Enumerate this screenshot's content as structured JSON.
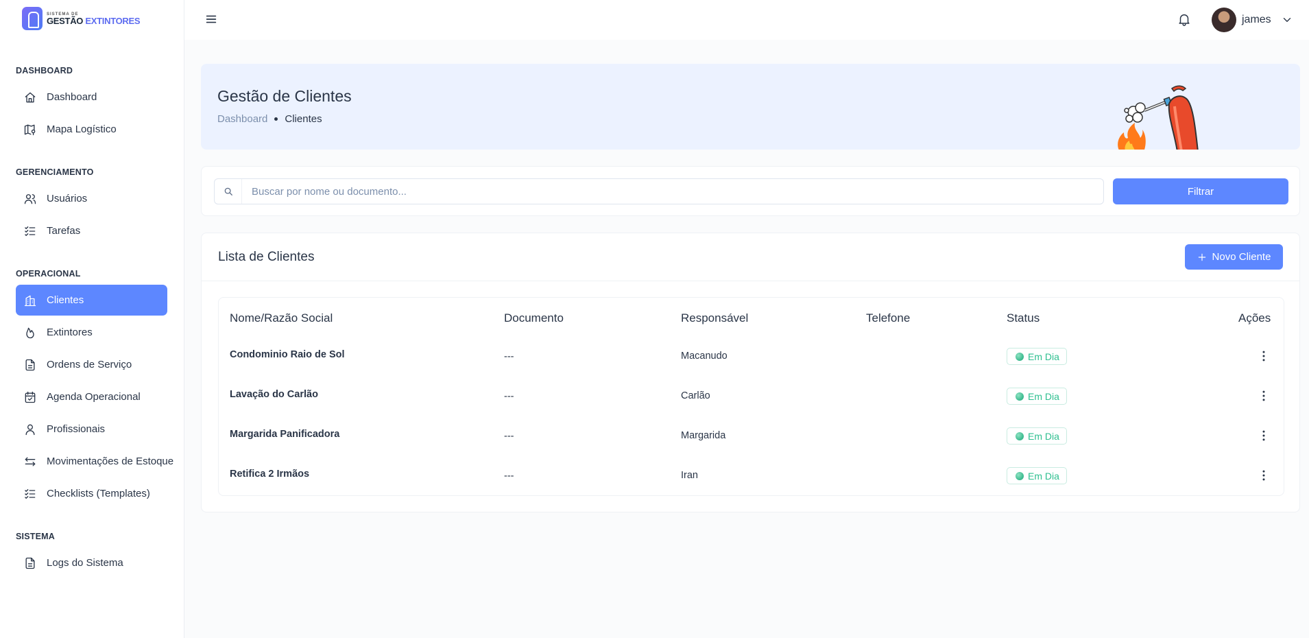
{
  "brand": {
    "small": "SISTEMA DE",
    "main": "GESTÃO",
    "accent": "EXTINTORES",
    "color": "#5d87ff"
  },
  "sidebar": {
    "sections": [
      {
        "title": "DASHBOARD"
      },
      {
        "title": "GERENCIAMENTO"
      },
      {
        "title": "OPERACIONAL"
      },
      {
        "title": "SISTEMA"
      }
    ],
    "items": [
      {
        "label": "Dashboard",
        "icon": "home-icon"
      },
      {
        "label": "Mapa Logístico",
        "icon": "map-icon"
      },
      {
        "label": "Usuários",
        "icon": "users-icon"
      },
      {
        "label": "Tarefas",
        "icon": "list-check-icon"
      },
      {
        "label": "Clientes",
        "icon": "building-icon",
        "active": true
      },
      {
        "label": "Extintores",
        "icon": "flame-icon"
      },
      {
        "label": "Ordens de Serviço",
        "icon": "file-text-icon"
      },
      {
        "label": "Agenda Operacional",
        "icon": "calendar-icon"
      },
      {
        "label": "Profissionais",
        "icon": "user-icon"
      },
      {
        "label": "Movimentações de Estoque",
        "icon": "arrows-exchange-icon"
      },
      {
        "label": "Checklists (Templates)",
        "icon": "list-check-icon"
      },
      {
        "label": "Logs do Sistema",
        "icon": "file-text-icon"
      }
    ]
  },
  "topbar": {
    "user_name": "james"
  },
  "banner": {
    "title": "Gestão de Clientes",
    "breadcrumb": [
      "Dashboard",
      "Clientes"
    ]
  },
  "search": {
    "placeholder": "Buscar por nome ou documento...",
    "value": "",
    "filter_label": "Filtrar"
  },
  "list": {
    "title": "Lista de Clientes",
    "new_label": "Novo Cliente",
    "columns": [
      "Nome/Razão Social",
      "Documento",
      "Responsável",
      "Telefone",
      "Status",
      "Ações"
    ],
    "rows": [
      {
        "name": "Condominio Raio de Sol",
        "document": "---",
        "responsible": "Macanudo",
        "phone": "",
        "status": "Em Dia"
      },
      {
        "name": "Lavação do Carlão",
        "document": "---",
        "responsible": "Carlão",
        "phone": "",
        "status": "Em Dia"
      },
      {
        "name": "Margarida Panificadora",
        "document": "---",
        "responsible": "Margarida",
        "phone": "",
        "status": "Em Dia"
      },
      {
        "name": "Retifica 2 Irmãos",
        "document": "---",
        "responsible": "Iran",
        "phone": "",
        "status": "Em Dia"
      }
    ]
  }
}
